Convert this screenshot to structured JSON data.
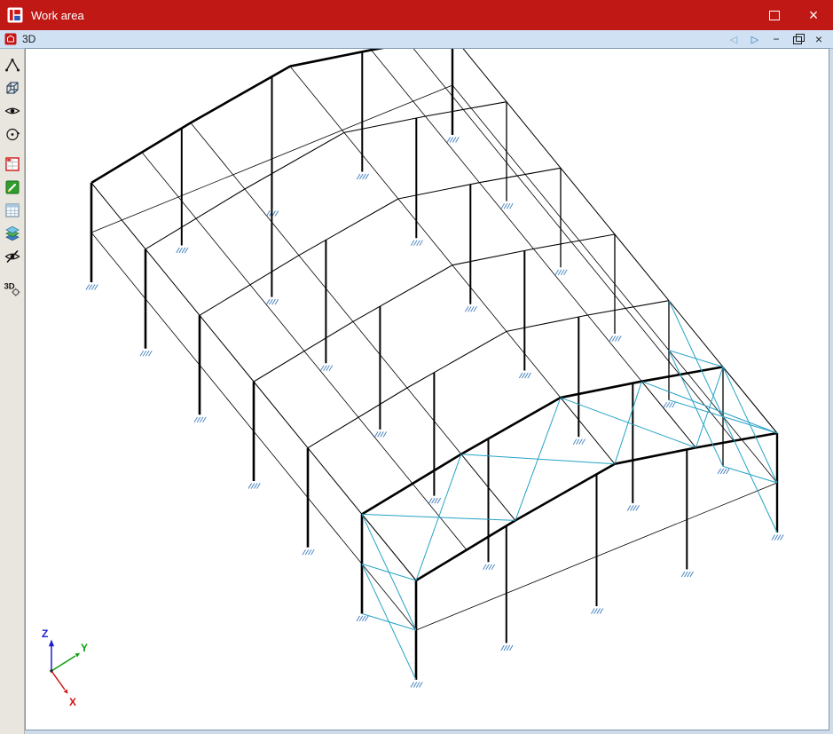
{
  "window": {
    "title": "Work area",
    "controls": {
      "maximize_icon": "maximize-box",
      "close_glyph": "×"
    }
  },
  "mdi": {
    "title": "3D",
    "controls": {
      "back_glyph": "◁",
      "forward_glyph": "▷",
      "minimize_glyph": "−",
      "restore_icon": "restore-box",
      "close_glyph": "×"
    }
  },
  "toolbar": {
    "items": [
      {
        "icon": "node-member-icon"
      },
      {
        "icon": "wire-cube-icon"
      },
      {
        "icon": "visibility-eye-icon"
      },
      {
        "icon": "orbit-rotate-icon"
      },
      {
        "icon": "activity-table-icon"
      },
      {
        "icon": "edit-green-icon"
      },
      {
        "icon": "numbers-table-icon"
      },
      {
        "icon": "layers-icon"
      },
      {
        "icon": "hide-eye-icon"
      },
      {
        "icon": "view-3d-settings-icon",
        "glyph": "3D"
      }
    ]
  },
  "axes": {
    "z_label": "Z",
    "y_label": "Y",
    "x_label": "X",
    "z_color": "#1f1fd0",
    "y_color": "#0a9f0a",
    "x_color": "#d01414"
  },
  "model": {
    "origin": [
      103,
      318
    ],
    "bay": [
      61,
      74.67
    ],
    "bays": 6,
    "span": [
      407,
      -166
    ],
    "stations": [
      0,
      0.275,
      0.55,
      0.775,
      1
    ],
    "station_heights": [
      112,
      134,
      152,
      133,
      112
    ],
    "purlins": [
      {
        "t": 0.14,
        "h": 123.2
      },
      {
        "t": 0.88,
        "h": 123.2
      }
    ],
    "eave_h": 112,
    "girt_h": 56,
    "gable_posts": [
      0.25,
      0.5,
      0.75
    ],
    "internal_rows": [
      0.35,
      0.75
    ],
    "colors": {
      "member": "#000000",
      "brace": "#24a3c6",
      "support": "#3a7abf"
    }
  }
}
